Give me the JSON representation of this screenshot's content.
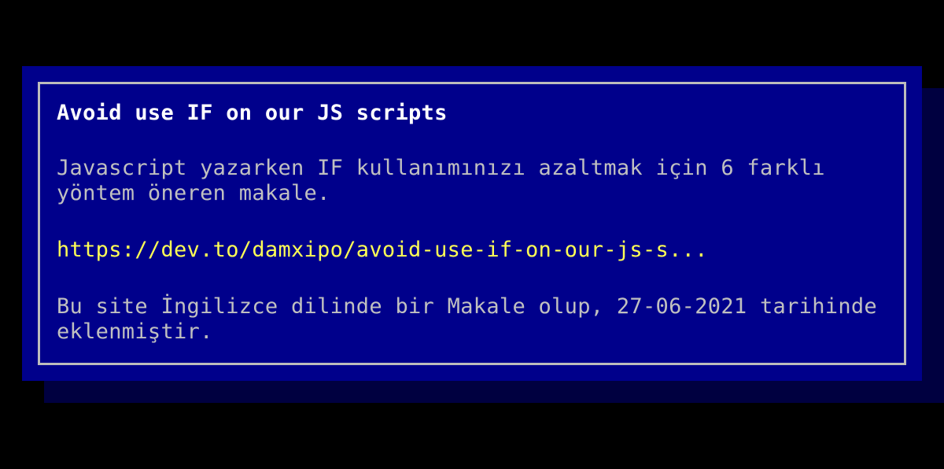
{
  "colors": {
    "background": "#000000",
    "dialog": "#00008b",
    "shadow": "#000040",
    "border": "#bcbcbc",
    "title": "#ffffff",
    "text": "#c0c0c0",
    "link": "#ffff55"
  },
  "article": {
    "title": "Avoid use IF on our JS scripts",
    "description": "Javascript yazarken IF kullanımınızı azaltmak için 6 farklı yöntem öneren makale.",
    "link_text": "https://dev.to/damxipo/avoid-use-if-on-our-js-s...",
    "footer": "Bu site İngilizce dilinde bir Makale olup, 27-06-2021 tarihinde eklenmiştir."
  }
}
